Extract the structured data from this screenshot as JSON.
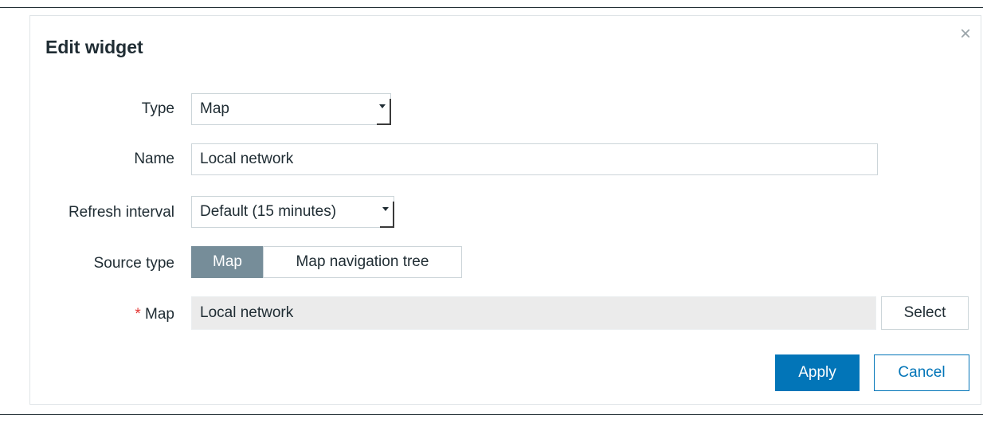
{
  "dialog": {
    "title": "Edit widget",
    "close_glyph": "×",
    "close_icon": "close-icon"
  },
  "form": {
    "type": {
      "label": "Type",
      "value": "Map"
    },
    "name": {
      "label": "Name",
      "value": "Local network"
    },
    "refresh_interval": {
      "label": "Refresh interval",
      "value": "Default (15 minutes)"
    },
    "source_type": {
      "label": "Source type",
      "options": [
        "Map",
        "Map navigation tree"
      ],
      "selected": "Map"
    },
    "map": {
      "required_mark": "*",
      "label": "Map",
      "value": "Local network",
      "select_label": "Select"
    }
  },
  "footer": {
    "apply_label": "Apply",
    "cancel_label": "Cancel"
  },
  "colors": {
    "primary": "#0275b8",
    "segment_active": "#768d99",
    "required": "#e33734",
    "readonly_bg": "#ebebeb"
  }
}
